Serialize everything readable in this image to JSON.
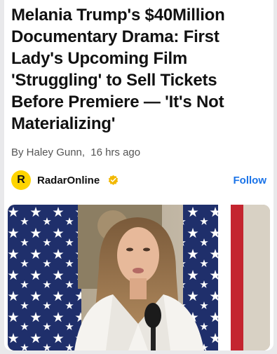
{
  "article": {
    "headline": "Melania Trump's $40Million Documentary Drama: First Lady's Upcoming Film 'Struggling' to Sell Tickets Before Premiere — 'It's Not Materializing'",
    "byline_author": "By Haley Gunn,",
    "byline_time": "16 hrs ago"
  },
  "publisher": {
    "logo_letter": "R",
    "name": "RadarOnline",
    "verified_icon": "verified-badge-icon",
    "follow_label": "Follow"
  },
  "colors": {
    "follow": "#1a73e8",
    "logo_bg": "#ffd400",
    "verified": "#f2b800"
  }
}
